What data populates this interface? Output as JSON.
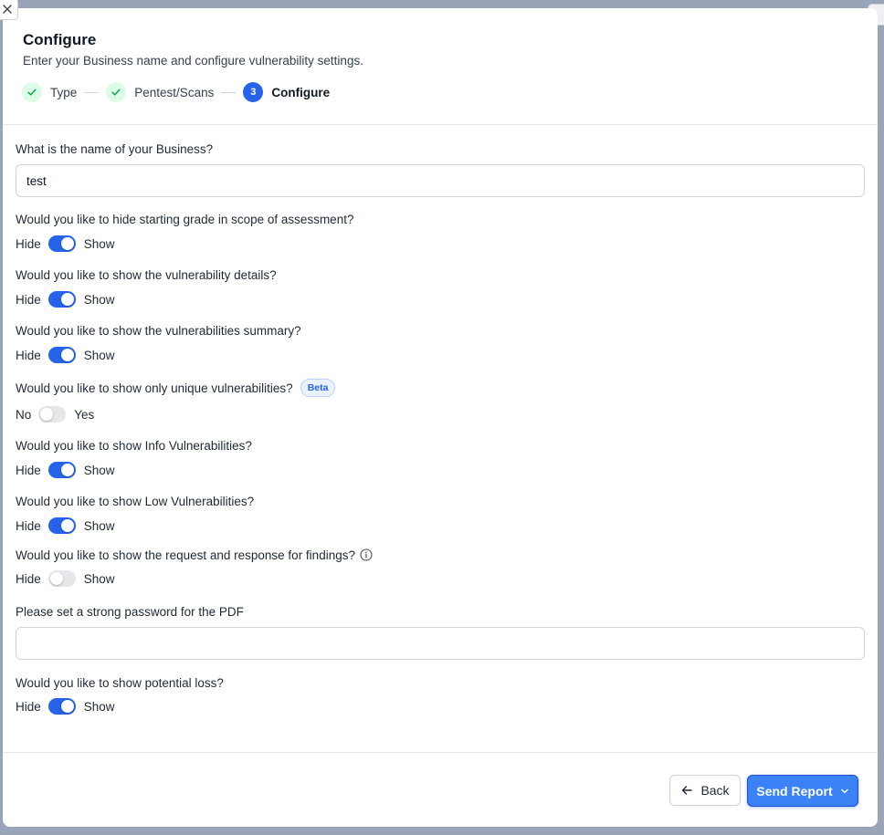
{
  "header": {
    "title": "Configure",
    "subtitle": "Enter your Business name and configure vulnerability settings.",
    "steps": [
      {
        "label": "Type",
        "status": "done"
      },
      {
        "label": "Pentest/Scans",
        "status": "done"
      },
      {
        "label": "Configure",
        "number": "3",
        "status": "active"
      }
    ]
  },
  "form": {
    "business_name": {
      "label": "What is the name of your Business?",
      "value": "test"
    },
    "hide_grade": {
      "label": "Would you like to hide starting grade in scope of assessment?",
      "off_label": "Hide",
      "on_label": "Show",
      "on": true
    },
    "vuln_details": {
      "label": "Would you like to show the vulnerability details?",
      "off_label": "Hide",
      "on_label": "Show",
      "on": true
    },
    "vuln_summary": {
      "label": "Would you like to show the vulnerabilities summary?",
      "off_label": "Hide",
      "on_label": "Show",
      "on": true
    },
    "unique_vulns": {
      "label": "Would you like to show only unique vulnerabilities?",
      "badge": "Beta",
      "off_label": "No",
      "on_label": "Yes",
      "on": false
    },
    "info_vulns": {
      "label": "Would you like to show Info Vulnerabilities?",
      "off_label": "Hide",
      "on_label": "Show",
      "on": true
    },
    "low_vulns": {
      "label": "Would you like to show Low Vulnerabilities?",
      "off_label": "Hide",
      "on_label": "Show",
      "on": true
    },
    "request_response": {
      "label": "Would you like to show the request and response for findings?",
      "off_label": "Hide",
      "on_label": "Show",
      "on": false
    },
    "pdf_password": {
      "label": "Please set a strong password for the PDF",
      "value": "",
      "placeholder": ""
    },
    "potential_loss": {
      "label": "Would you like to show potential loss?",
      "off_label": "Hide",
      "on_label": "Show",
      "on": true
    }
  },
  "footer": {
    "back_label": "Back",
    "send_label": "Send Report"
  },
  "colors": {
    "accent": "#2563eb",
    "success_bg": "#dcfce7",
    "success": "#16a34a"
  },
  "icons": {
    "close": "close-icon",
    "check": "check-icon",
    "back": "arrow-left-icon",
    "dropdown": "chevron-down-icon",
    "info": "info-icon"
  }
}
